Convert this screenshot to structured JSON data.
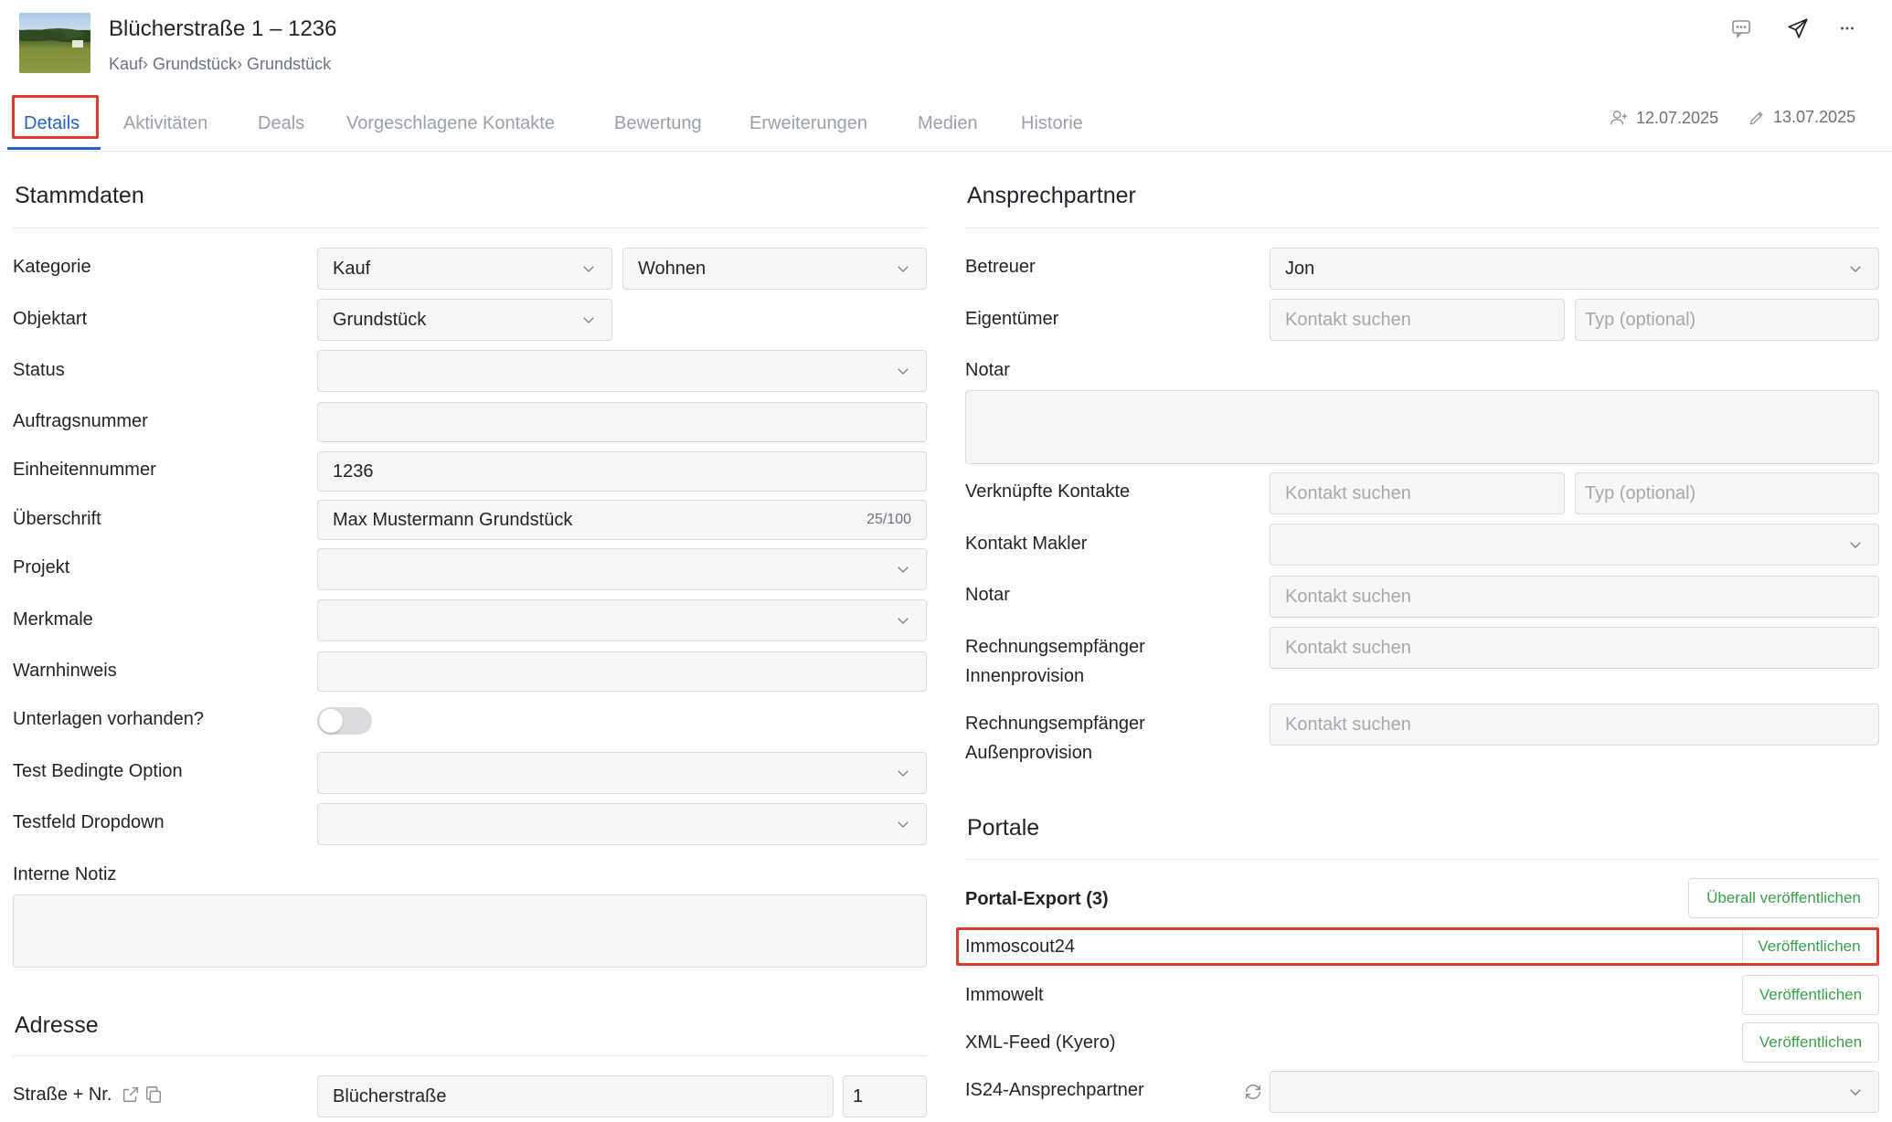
{
  "header": {
    "title": "Blücherstraße 1 – 1236",
    "breadcrumb": "Kauf› Grundstück› Grundstück"
  },
  "tabs": [
    {
      "label": "Details"
    },
    {
      "label": "Aktivitäten"
    },
    {
      "label": "Deals"
    },
    {
      "label": "Vorgeschlagene Kontakte"
    },
    {
      "label": "Bewertung"
    },
    {
      "label": "Erweiterungen"
    },
    {
      "label": "Medien"
    },
    {
      "label": "Historie"
    }
  ],
  "meta": {
    "created": "12.07.2025",
    "edited": "13.07.2025"
  },
  "stammdaten": {
    "title": "Stammdaten",
    "kategorie": {
      "label": "Kategorie",
      "value1": "Kauf",
      "value2": "Wohnen"
    },
    "objektart": {
      "label": "Objektart",
      "value": "Grundstück"
    },
    "status": {
      "label": "Status",
      "value": ""
    },
    "auftragsnummer": {
      "label": "Auftragsnummer",
      "value": ""
    },
    "einheitennummer": {
      "label": "Einheitennummer",
      "value": "1236"
    },
    "ueberschrift": {
      "label": "Überschrift",
      "value": "Max Mustermann Grundstück",
      "counter": "25/100"
    },
    "projekt": {
      "label": "Projekt",
      "value": ""
    },
    "merkmale": {
      "label": "Merkmale",
      "value": ""
    },
    "warnhinweis": {
      "label": "Warnhinweis",
      "value": ""
    },
    "unterlagen": {
      "label": "Unterlagen vorhanden?",
      "on": false
    },
    "test_bedingte": {
      "label": "Test Bedingte Option",
      "value": ""
    },
    "testfeld": {
      "label": "Testfeld Dropdown",
      "value": ""
    },
    "interne_notiz": {
      "label": "Interne Notiz",
      "value": ""
    }
  },
  "adresse": {
    "title": "Adresse",
    "strasse": {
      "label": "Straße + Nr.",
      "street": "Blücherstraße",
      "number": "1"
    }
  },
  "ansprechpartner": {
    "title": "Ansprechpartner",
    "betreuer": {
      "label": "Betreuer",
      "value": "Jon"
    },
    "eigentuemer": {
      "label": "Eigentümer",
      "placeholder": "Kontakt suchen",
      "type_placeholder": "Typ (optional)"
    },
    "notar_notes": {
      "label": "Notar"
    },
    "verknuepfte": {
      "label": "Verknüpfte Kontakte",
      "placeholder": "Kontakt suchen",
      "type_placeholder": "Typ (optional)"
    },
    "kontakt_makler": {
      "label": "Kontakt Makler",
      "value": ""
    },
    "notar": {
      "label": "Notar",
      "placeholder": "Kontakt suchen"
    },
    "re_innen": {
      "label_line1": "Rechnungsempfänger",
      "label_line2": "Innenprovision",
      "placeholder": "Kontakt suchen"
    },
    "re_aussen": {
      "label_line1": "Rechnungsempfänger",
      "label_line2": "Außenprovision",
      "placeholder": "Kontakt suchen"
    }
  },
  "portale": {
    "title": "Portale",
    "export_label": "Portal-Export (3)",
    "publish_all": "Überall veröffentlichen",
    "items": [
      {
        "name": "Immoscout24",
        "action": "Veröffentlichen"
      },
      {
        "name": "Immowelt",
        "action": "Veröffentlichen"
      },
      {
        "name": "XML-Feed (Kyero)",
        "action": "Veröffentlichen"
      }
    ],
    "is24": {
      "label": "IS24-Ansprechpartner",
      "value": ""
    }
  }
}
